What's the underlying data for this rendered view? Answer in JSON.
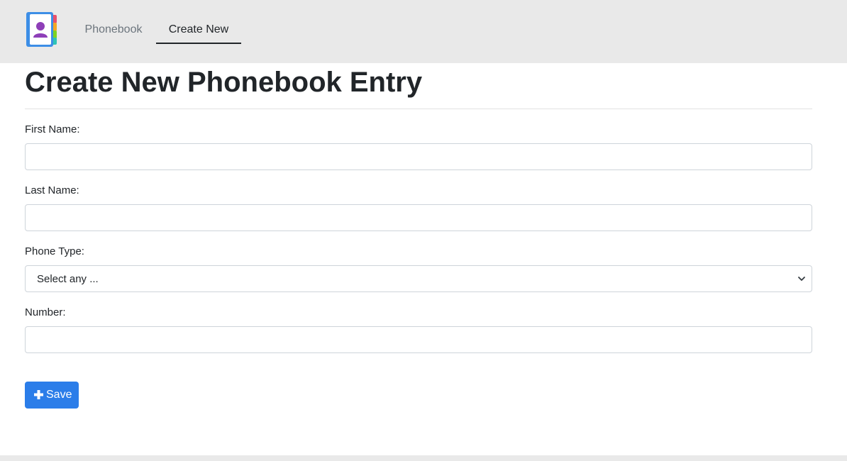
{
  "nav": {
    "items": [
      {
        "label": "Phonebook",
        "active": false
      },
      {
        "label": "Create New",
        "active": true
      }
    ]
  },
  "page": {
    "title": "Create New Phonebook Entry"
  },
  "form": {
    "first_name": {
      "label": "First Name:",
      "value": ""
    },
    "last_name": {
      "label": "Last Name:",
      "value": ""
    },
    "phone_type": {
      "label": "Phone Type:",
      "selected": "Select any ..."
    },
    "number": {
      "label": "Number:",
      "value": ""
    },
    "save_label": "Save"
  },
  "colors": {
    "accent": "#2b7de9",
    "navbar_bg": "#e9e9e9"
  }
}
